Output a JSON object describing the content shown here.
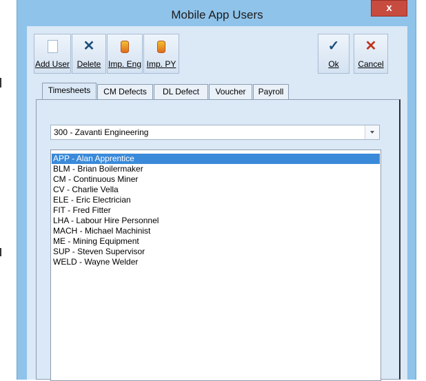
{
  "window": {
    "title": "Mobile App Users",
    "close_glyph": "x"
  },
  "toolbar": {
    "buttons": [
      {
        "label": "Add User",
        "icon": "new-document-icon"
      },
      {
        "label": "Delete",
        "icon": "delete-x-icon"
      },
      {
        "label": "Imp. Eng",
        "icon": "database-import-icon"
      },
      {
        "label": "Imp. PY",
        "icon": "database-import-icon"
      },
      {
        "label": "Ok",
        "icon": "checkmark-icon"
      },
      {
        "label": "Cancel",
        "icon": "cancel-x-icon"
      }
    ]
  },
  "tabs": [
    "Timesheets",
    "CM Defects",
    "DL Defect",
    "Voucher",
    "Payroll"
  ],
  "active_tab": "Timesheets",
  "company_select": {
    "value": "300 - Zavanti Engineering"
  },
  "users": [
    "APP - Alan  Apprentice",
    "BLM - Brian Boilermaker",
    "CM - Continuous  Miner",
    "CV - Charlie Vella",
    "ELE - Eric Electrician",
    "FIT - Fred Fitter",
    "LHA - Labour Hire  Personnel",
    "MACH - Michael Machinist",
    "ME - Mining Equipment",
    "SUP - Steven  Supervisor",
    "WELD - Wayne Welder"
  ],
  "selected_user": "APP - Alan  Apprentice",
  "colors": {
    "window_frame": "#8fc3ea",
    "client_bg": "#dbe8f6",
    "selection": "#3a8ad9",
    "close_button": "#c74b3f"
  }
}
